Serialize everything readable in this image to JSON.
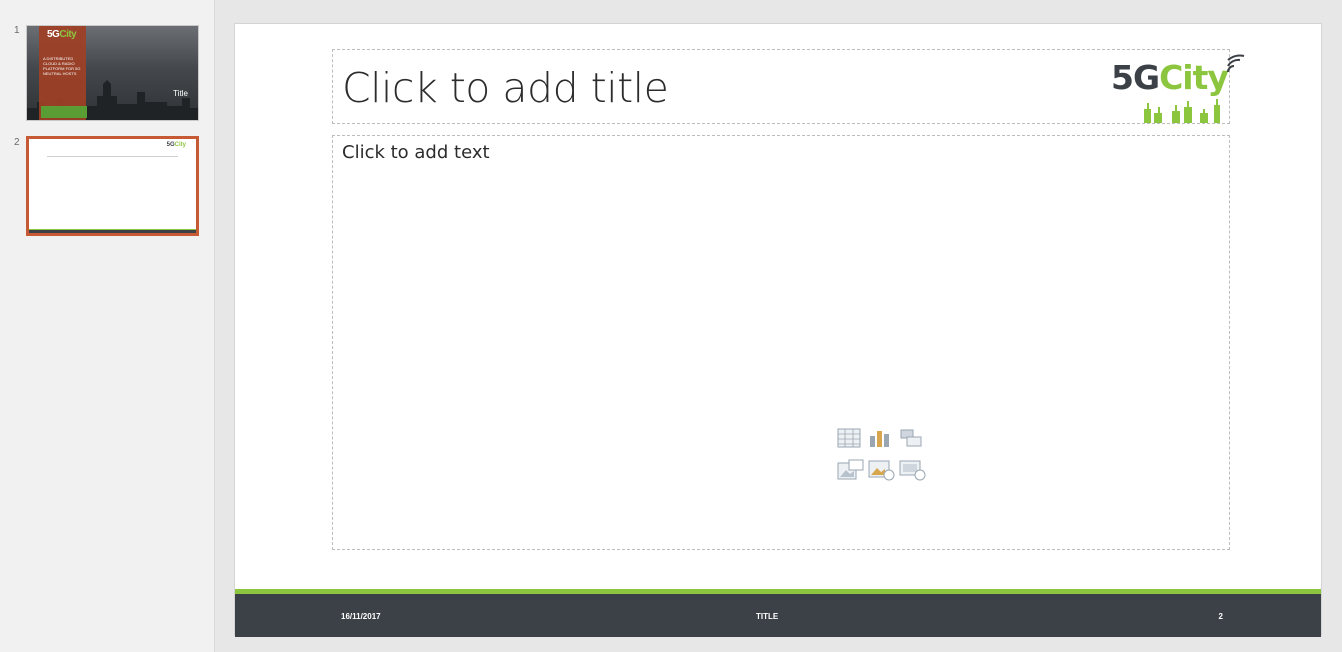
{
  "thumbnails": [
    {
      "number": "1",
      "logo_lead": "5G",
      "logo_tail": "City",
      "text": "A DISTRIBUTED CLOUD & RADIO PLATFORM FOR 5G NEUTRAL HOSTS",
      "title": "Title"
    },
    {
      "number": "2",
      "logo_lead": "5G",
      "logo_tail": "City"
    }
  ],
  "slide": {
    "title_placeholder": "Click to add title",
    "body_placeholder": "Click to add text",
    "logo": {
      "lead": "5G",
      "tail": "City"
    },
    "insert_icons": [
      "table-icon",
      "chart-icon",
      "smartart-icon",
      "picture-icon",
      "online-picture-icon",
      "video-icon"
    ],
    "footer": {
      "date": "16/11/2017",
      "title": "TITLE",
      "slide_number": "2"
    }
  },
  "colors": {
    "accent_green": "#8cc63f",
    "footer_dark": "#3b4147",
    "selected_border": "#c55a35"
  }
}
